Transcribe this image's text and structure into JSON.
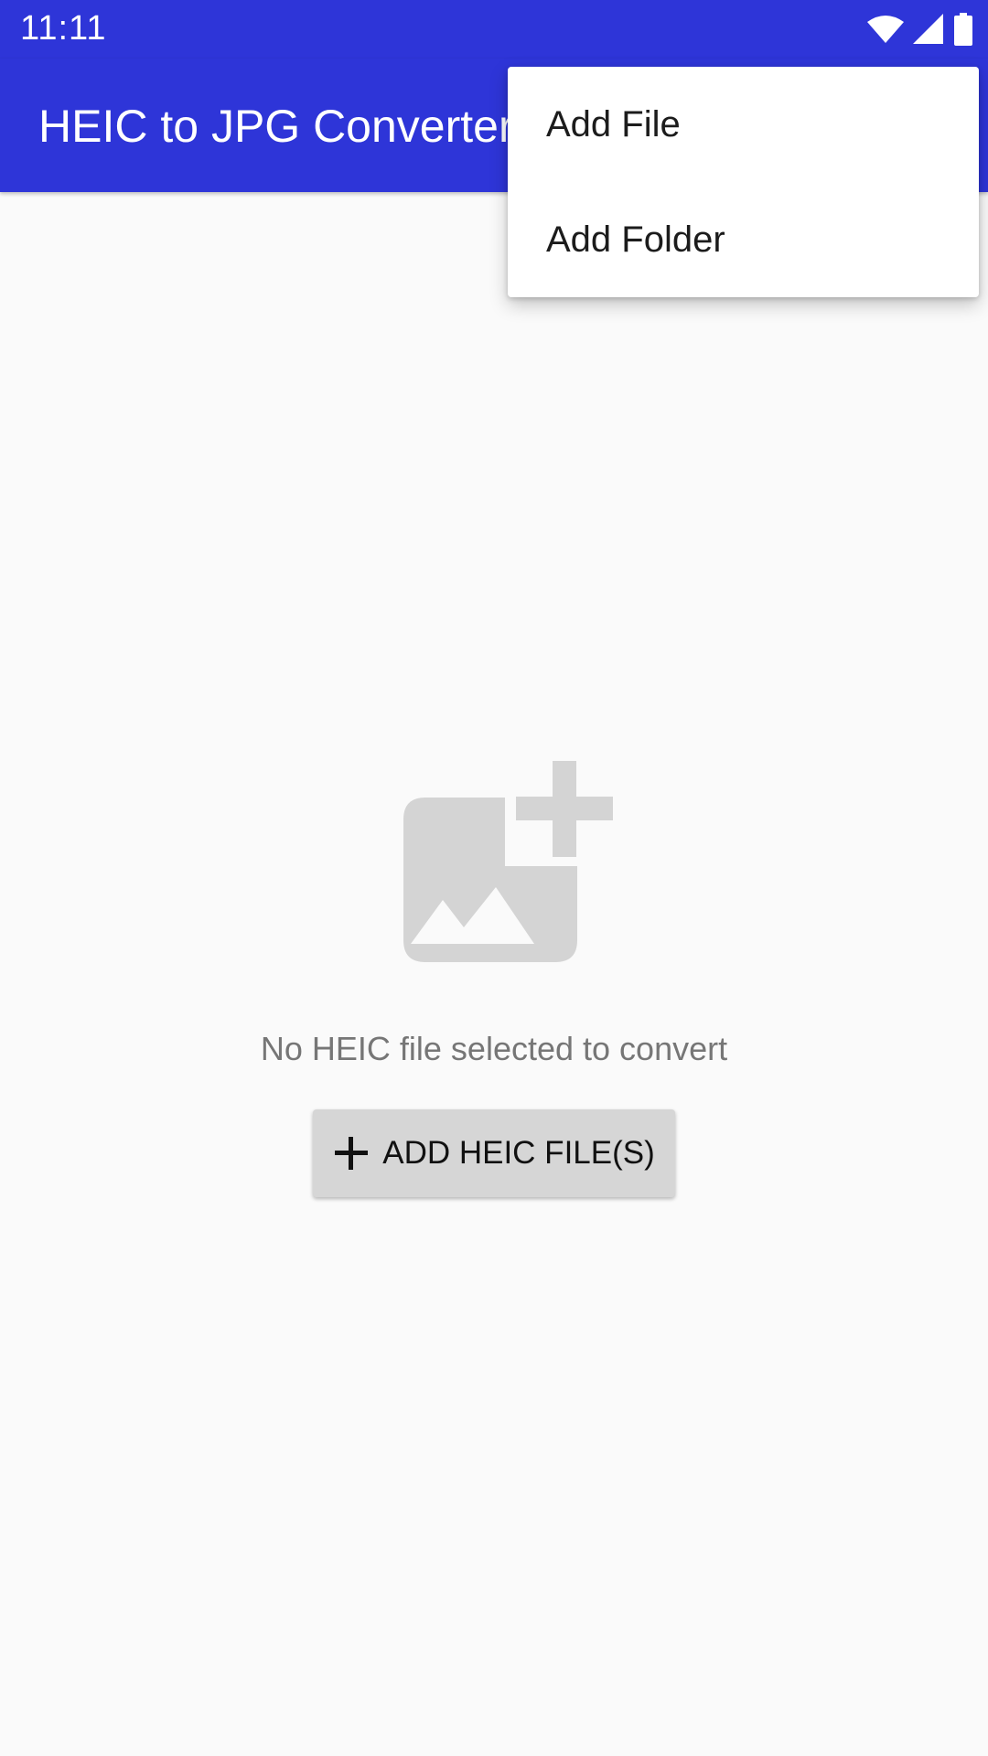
{
  "status_bar": {
    "time": "11:11",
    "icons": [
      "wifi-icon",
      "cell-signal-icon",
      "battery-icon"
    ]
  },
  "app_bar": {
    "title": "HEIC to JPG Converter",
    "background": "#2e35d8"
  },
  "empty_state": {
    "icon": "add-image-icon",
    "message": "No HEIC file selected to convert",
    "button_label": "ADD HEIC FILE(S)",
    "button_icon": "plus-icon"
  },
  "popup_menu": {
    "items": [
      {
        "label": "Add File"
      },
      {
        "label": "Add Folder"
      }
    ]
  }
}
